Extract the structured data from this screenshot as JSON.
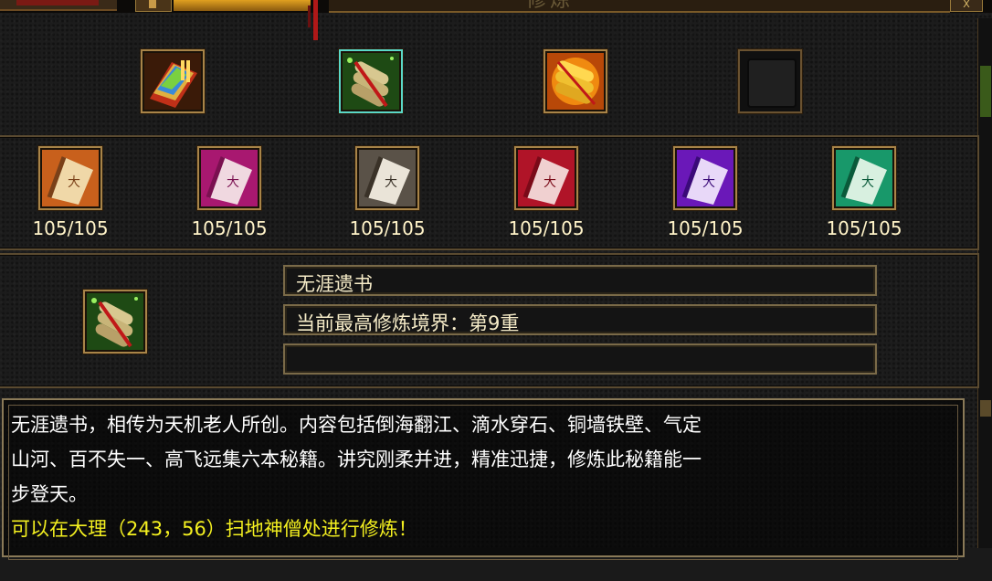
{
  "window": {
    "title": "修炼",
    "close_label": "X"
  },
  "top_items": [
    {
      "icon": "rainbow-book-icon",
      "selected": false,
      "empty": false
    },
    {
      "icon": "green-scroll-bundle-icon",
      "selected": true,
      "empty": false
    },
    {
      "icon": "golden-scroll-bundle-icon",
      "selected": false,
      "empty": false
    },
    {
      "icon": "empty-slot-icon",
      "selected": false,
      "empty": true
    }
  ],
  "skills": [
    {
      "icon": "orange-scroll-icon",
      "count": "105/105"
    },
    {
      "icon": "pink-scroll-icon",
      "count": "105/105"
    },
    {
      "icon": "white-scroll-icon",
      "count": "105/105"
    },
    {
      "icon": "red-scroll-icon",
      "count": "105/105"
    },
    {
      "icon": "purple-scroll-icon",
      "count": "105/105"
    },
    {
      "icon": "teal-scroll-icon",
      "count": "105/105"
    }
  ],
  "selected": {
    "icon": "green-scroll-bundle-icon",
    "name": "无涯遗书",
    "realm": "当前最高修炼境界：第9重",
    "extra": ""
  },
  "description": {
    "line1": "无涯遗书，相传为天机老人所创。内容包括倒海翻江、滴水穿石、铜墙铁壁、气定",
    "line2": "山河、百不失一、高飞远集六本秘籍。讲究刚柔并进，精准迅捷，修炼此秘籍能一",
    "line3": "步登天。",
    "line4": "可以在大理（243，56）扫地神僧处进行修炼！",
    "line5": ""
  },
  "colors": {
    "frame_gold": "#a88448",
    "selected_border": "#5ad8c8",
    "hint_yellow": "#f4f020",
    "hint_green": "#3ad83a"
  }
}
